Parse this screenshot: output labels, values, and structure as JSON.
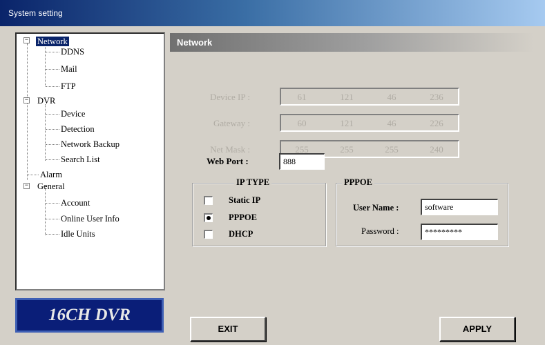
{
  "window": {
    "title": "System setting"
  },
  "tree": {
    "network": "Network",
    "ddns": "DDNS",
    "mail": "Mail",
    "ftp": "FTP",
    "dvr": "DVR",
    "device": "Device",
    "detection": "Detection",
    "network_backup": "Network Backup",
    "search_list": "Search List",
    "alarm": "Alarm",
    "general": "General",
    "account": "Account",
    "online_user_info": "Online User Info",
    "idle_units": "Idle Units",
    "expander_symbol": "−"
  },
  "logo": {
    "text": "16CH DVR"
  },
  "panel": {
    "title": "Network",
    "device_ip": {
      "label": "Device IP :",
      "octets": [
        "61",
        "121",
        "46",
        "236"
      ]
    },
    "gateway": {
      "label": "Gateway :",
      "octets": [
        "60",
        "121",
        "46",
        "226"
      ]
    },
    "net_mask": {
      "label": "Net Mask :",
      "octets": [
        "255",
        "255",
        "255",
        "240"
      ]
    },
    "web_port": {
      "label": "Web Port :",
      "value": "888"
    },
    "ip_type": {
      "title": "IP TYPE",
      "options": [
        {
          "label": "Static IP",
          "checked": false
        },
        {
          "label": "PPPOE",
          "checked": true
        },
        {
          "label": "DHCP",
          "checked": false
        }
      ]
    },
    "pppoe": {
      "title": "PPPOE",
      "user_name_label": "User Name :",
      "user_name_value": "software",
      "password_label": "Password :",
      "password_value": "*********"
    }
  },
  "buttons": {
    "exit": "EXIT",
    "apply": "APPLY"
  }
}
